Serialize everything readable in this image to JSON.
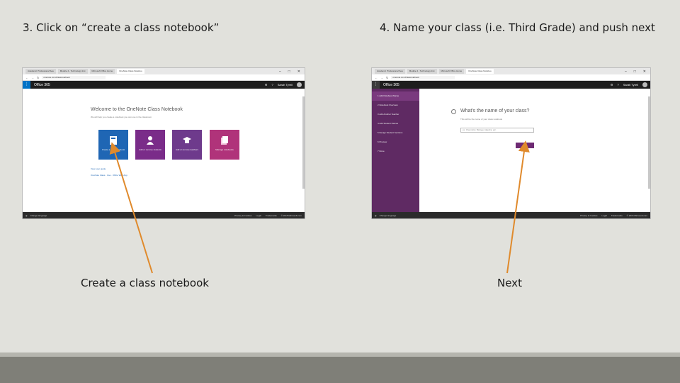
{
  "slide": {
    "step3_title": "3. Click on “create a class notebook”",
    "step4_title": "4. Name your class (i.e. Third Grade) and push next",
    "caption_left": "Create a class notebook",
    "caption_right": "Next"
  },
  "shot_left": {
    "tabs": [
      "Academic Professional Sea",
      "Module 4 - Technology Inst",
      "Microsoft Office Home",
      "OneNote Class Noteboo"
    ],
    "address": "onenote.com/classnotebook",
    "app_title": "Office 365",
    "user_name": "Sarah Tyrell",
    "welcome_title": "Welcome to the OneNote Class Notebook",
    "welcome_subtitle": "We will help you create a notebook you can use in the classroom",
    "tiles": [
      {
        "label": "Create a class notebook"
      },
      {
        "label": "Add or remove students"
      },
      {
        "label": "Add or remove teachers"
      },
      {
        "label": "Manage notebooks"
      }
    ],
    "guide_link": "View user guide",
    "guide_link2": "OneNote Class · Use · Office Web App",
    "status_left": "Change language",
    "status_links": [
      "Privacy & Cookies",
      "Legal",
      "Trademarks",
      "© 2015 Microsoft.com"
    ]
  },
  "shot_right": {
    "tabs": [
      "Academic Professional Sea",
      "Module 4 - Technology Inst",
      "Microsoft Office Home",
      "OneNote Class Noteboo"
    ],
    "address": "onenote.com/classnotebook",
    "app_title": "Office 365",
    "user_name": "Sarah Tyrell",
    "nav_items": [
      "1 Add Notebook Name",
      "2 Notebook Overview",
      "3 Add Another Teacher",
      "4 Add Student Names",
      "5 Design Student Sections",
      "6 Preview",
      "7 Done"
    ],
    "question_title": "What's the name of your class?",
    "question_subtitle": "This will be the name of your class notebook",
    "input_placeholder": "ex: Chemistry, Biology, Algebra, etc.",
    "next_label": "Next",
    "status_left": "Change language",
    "status_links": [
      "Privacy & Cookies",
      "Legal",
      "Trademarks",
      "© 2015 Microsoft.com"
    ]
  },
  "colors": {
    "arrow": "#e08a2c",
    "office_blue": "#0072c6",
    "nav_purple": "#5f2a63",
    "tile_blue": "#1f66b4"
  }
}
